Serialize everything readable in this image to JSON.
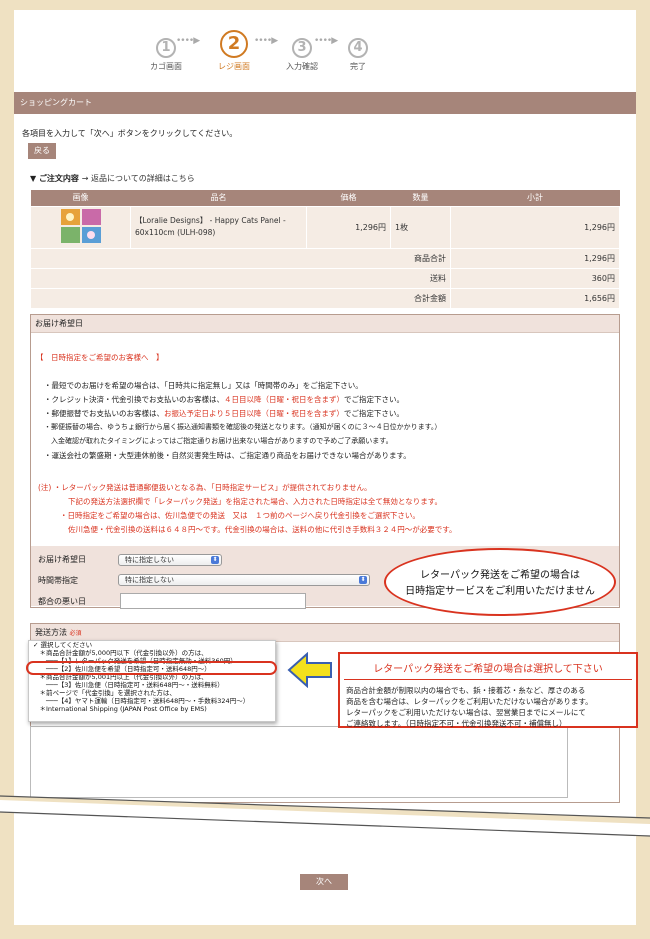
{
  "steps": [
    {
      "num": "1",
      "label": "カゴ画面"
    },
    {
      "num": "2",
      "label": "レジ画面"
    },
    {
      "num": "3",
      "label": "入力確認"
    },
    {
      "num": "4",
      "label": "完了"
    }
  ],
  "step_arrow": "••••▶",
  "header_title": "ショッピングカート",
  "instruction": "各項目を入力して「次へ」ボタンをクリックしてください。",
  "back_button": "戻る",
  "order_heading": "▼ ご注文内容",
  "return_link": "→ 返品についての詳細はこちら",
  "table": {
    "headers": [
      "画像",
      "品名",
      "価格",
      "数量",
      "小計"
    ],
    "item": {
      "name": "【Loralie Designs】 - Happy Cats Panel - 60x110cm (ULH-098)",
      "price": "1,296円",
      "qty": "1枚",
      "subtotal": "1,296円"
    },
    "summary": [
      {
        "label": "商品合計",
        "value": "1,296円"
      },
      {
        "label": "送料",
        "value": "360円"
      },
      {
        "label": "合計金額",
        "value": "1,656円"
      }
    ]
  },
  "delivery": {
    "heading": "お届け希望日",
    "intro": "【　日時指定をご希望のお客様へ　】",
    "lines": [
      "・最短でのお届けを希望の場合は、「日時共に指定無し」又は「時間帯のみ」をご指定下さい。",
      "・クレジット決済・代金引換でお支払いのお客様は、",
      "４日目以降（日曜・祝日を含まず）",
      "でご指定下さい。",
      "・郵便振替でお支払いのお客様は、",
      "お振込予定日より５日目以降（日曜・祝日を含まず）",
      "でご指定下さい。",
      "・郵便振替の場合、ゆうちょ銀行から届く振込通知書類を確認後の発送となります。（通知が届くのに３～４日位かかります。）",
      "　入金確認が取れたタイミングによってはご指定通りお届け出来ない場合がありますので予めご了承願います。",
      "・運送会社の繁盛期・大型連休前後・自然災害発生時は、ご指定通り商品をお届けできない場合があります。"
    ],
    "notes": [
      "(注) ・レターパック発送は普通郵便扱いとなる為、「日時指定サービス」が提供されておりません。",
      "下記の発送方法選択欄で「レターパック発送」を指定された場合、入力された日時指定は全て無効となります。",
      "・日時指定をご希望の場合は、佐川急便での発送　又は　１つ前のページへ戻り代金引換をご選択下さい。",
      "佐川急便・代金引換の送料は６４８円～です。代金引換の場合は、送料の他に代引き手数料３２４円～が必要です。"
    ],
    "fields": {
      "date_label": "お届け希望日",
      "date_value": "特に指定しない",
      "time_label": "時間帯指定",
      "time_value": "特に指定しない",
      "ng_label": "都合の悪い日"
    },
    "callout_line1": "レターパック発送をご希望の場合は",
    "callout_line2": "日時指定サービスをご利用いただけません"
  },
  "shipping": {
    "heading": "発送方法",
    "required": "必須",
    "options": [
      "✓ 選択してください",
      "　＊商品合計金額が5,000円以下（代金引換以外）の方は、",
      "　　───【1】レターパック発送を希望（日時指定無効・送料360円）",
      "　　───【2】佐川急便を希望（日時指定可・送料648円～）",
      "　＊商品合計金額が5,001円以上（代金引換以外）の方は、",
      "　　───【3】佐川急便（日時指定可・送料648円～・送料無料）",
      "　＊前ページで「代金引換」を選択された方は、",
      "　　───【4】ヤマト運輸（日時指定可・送料648円～・手数料324円～）",
      "　＊International Shipping (JAPAN Post Office by EMS)"
    ],
    "callout_title": "レターパック発送をご希望の場合は選択して下さい",
    "callout_body": [
      "商品合計金額が制限以内の場合でも、鋲・接着芯・糸など、厚さのある",
      "商品を含む場合は、レターパックをご利用いただけない場合があります。",
      "レターパックをご利用いただけない場合は、翌営業日までにメールにて",
      "ご連絡致します。（日時指定不可・代金引換発送不可・補償無し）"
    ]
  },
  "next_button": "次へ",
  "colors": {
    "band": "#a6857a",
    "accent": "#d07a22",
    "red": "#d9331f",
    "background": "#efe1c2"
  }
}
